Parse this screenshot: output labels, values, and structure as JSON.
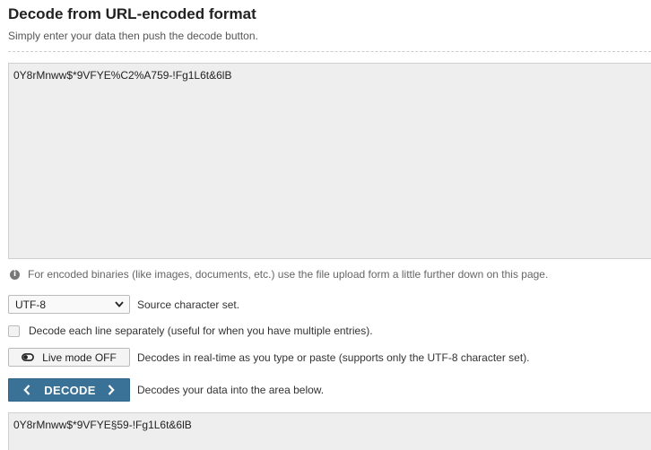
{
  "header": {
    "title": "Decode from URL-encoded format",
    "subtitle": "Simply enter your data then push the decode button."
  },
  "input": {
    "value": "0Y8rMnww$*9VFYE%C2%A759-!Fg1L6t&6lB"
  },
  "note": {
    "icon": "info-icon",
    "text": "For encoded binaries (like images, documents, etc.) use the file upload form a little further down on this page."
  },
  "charset": {
    "selected": "UTF-8",
    "label": "Source character set."
  },
  "each_line": {
    "checked": false,
    "label": "Decode each line separately (useful for when you have multiple entries)."
  },
  "live_mode": {
    "button_label": "Live mode OFF",
    "description": "Decodes in real-time as you type or paste (supports only the UTF-8 character set)."
  },
  "decode": {
    "button_label": "DECODE",
    "description": "Decodes your data into the area below."
  },
  "output": {
    "value": "0Y8rMnww$*9VFYE§59-!Fg1L6t&6lB"
  },
  "colors": {
    "accent": "#3a7196",
    "field_bg": "#eeeeee"
  }
}
